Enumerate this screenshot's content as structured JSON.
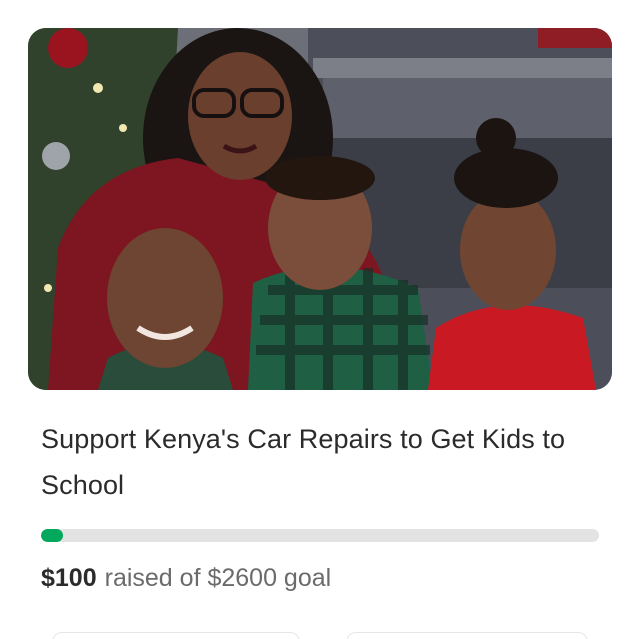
{
  "campaign": {
    "title": "Support Kenya's Car Repairs to Get Kids to School",
    "raised_amount": "$100",
    "goal_text": "raised of $2600 goal",
    "progress_fraction": 0.04,
    "colors": {
      "progress_fill": "#02a95c",
      "progress_track": "#e3e3e3",
      "title_text": "#2b2b2b",
      "secondary_text": "#6b6b6b"
    }
  }
}
